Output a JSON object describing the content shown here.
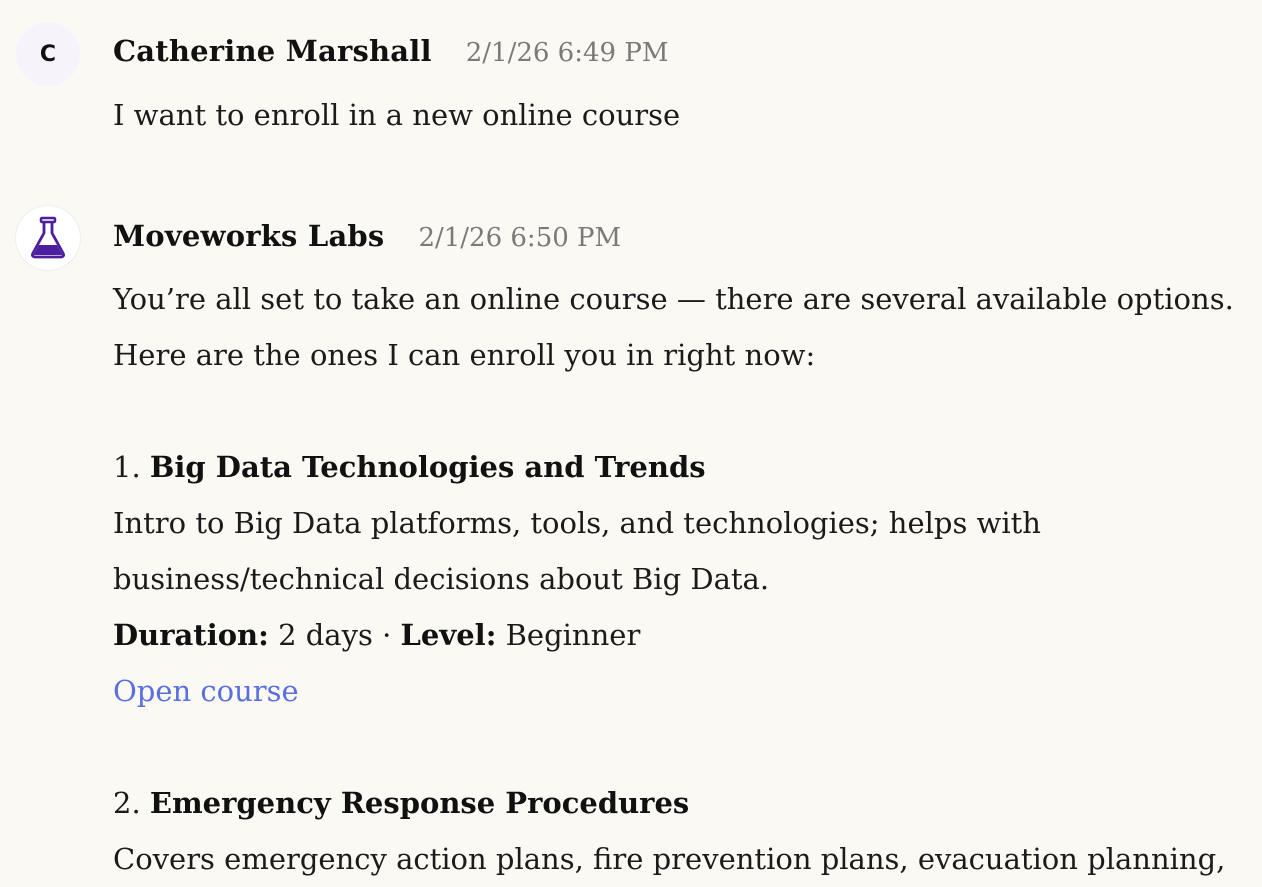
{
  "messages": [
    {
      "avatar_letter": "C",
      "sender": "Catherine Marshall",
      "timestamp": "2/1/26 6:49 PM",
      "text": "I want to enroll in a new online course"
    },
    {
      "avatar_icon": "flask-icon",
      "sender": "Moveworks Labs",
      "timestamp": "2/1/26 6:50 PM",
      "intro_line1": "You’re all set to take an online course — there are several available options.",
      "intro_line2": "Here are the ones I can enroll you in right now:",
      "courses": [
        {
          "number": "1.",
          "title": "Big Data Technologies and Trends",
          "desc_line1": "Intro to Big Data platforms, tools, and technologies; helps with",
          "desc_line2": "business/technical decisions about Big Data.",
          "duration_label": "Duration:",
          "duration_value": "2 days",
          "separator": "·",
          "level_label": "Level:",
          "level_value": "Beginner",
          "link_label": "Open course"
        },
        {
          "number": "2.",
          "title": "Emergency Response Procedures",
          "desc_line1": "Covers emergency action plans, fire prevention plans, evacuation planning,"
        }
      ]
    }
  ],
  "colors": {
    "background": "#fbf9f4",
    "link": "#5a6fe0",
    "timestamp": "#7a7a7a",
    "flask_purple": "#4b1fa0"
  }
}
